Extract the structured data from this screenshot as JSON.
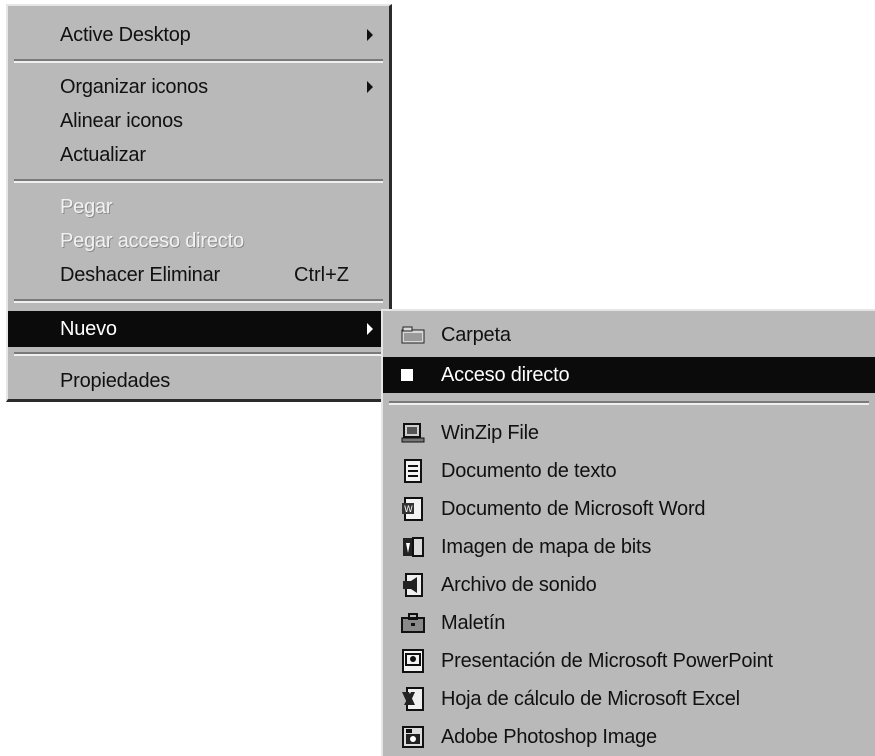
{
  "context_menu": {
    "items": [
      {
        "label": "Active Desktop",
        "has_submenu": true
      },
      {
        "label": "Organizar iconos",
        "has_submenu": true
      },
      {
        "label": "Alinear iconos"
      },
      {
        "label": "Actualizar"
      },
      {
        "label": "Pegar",
        "disabled": true
      },
      {
        "label": "Pegar acceso directo",
        "disabled": true
      },
      {
        "label": "Deshacer Eliminar",
        "shortcut": "Ctrl+Z"
      },
      {
        "label": "Nuevo",
        "has_submenu": true,
        "highlighted": true
      },
      {
        "label": "Propiedades"
      }
    ]
  },
  "new_submenu": {
    "items": [
      {
        "label": "Carpeta",
        "icon": "folder-icon"
      },
      {
        "label": "Acceso directo",
        "icon": "shortcut-icon",
        "highlighted": true
      },
      {
        "label": "WinZip File",
        "icon": "winzip-icon"
      },
      {
        "label": "Documento de texto",
        "icon": "text-document-icon"
      },
      {
        "label": "Documento de Microsoft Word",
        "icon": "word-document-icon"
      },
      {
        "label": "Imagen de mapa de bits",
        "icon": "bitmap-image-icon"
      },
      {
        "label": "Archivo de sonido",
        "icon": "sound-file-icon"
      },
      {
        "label": "Maletín",
        "icon": "briefcase-icon"
      },
      {
        "label": "Presentación de Microsoft PowerPoint",
        "icon": "powerpoint-icon"
      },
      {
        "label": "Hoja de cálculo de Microsoft Excel",
        "icon": "excel-icon"
      },
      {
        "label": "Adobe Photoshop Image",
        "icon": "photoshop-icon"
      }
    ]
  },
  "colors": {
    "menu_background": "#b9b9b9",
    "highlight_background": "#0b0b0b",
    "highlight_text": "#ffffff",
    "disabled_text": "#f2f2f2"
  }
}
